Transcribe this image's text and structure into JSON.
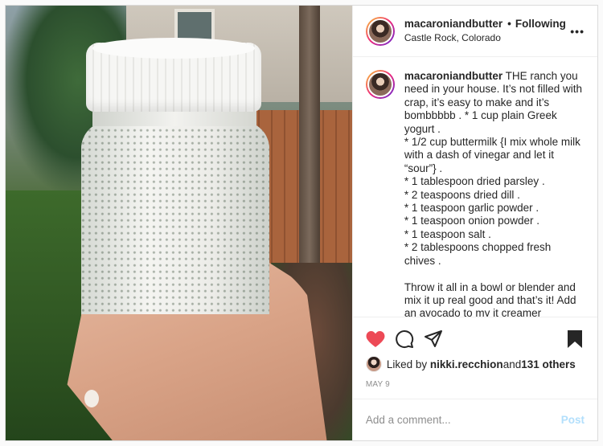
{
  "post": {
    "username": "macaroniandbutter",
    "follow_status": "Following",
    "location": "Castle Rock, Colorado",
    "more_label": "•••",
    "caption_text": " THE ranch you need in your house. It’s not filled with crap, it’s easy to make and it’s bombbbbb . * 1 cup plain Greek yogurt .\n* 1/2 cup buttermilk {I mix whole milk with a dash of vinegar and let it “sour”} .\n* 1 tablespoon dried parsley .\n* 2 teaspoons dried dill .\n* 1 teaspoon garlic powder .\n* 1 teaspoon onion powder .\n* 1 teaspoon salt .\n* 2 tablespoons chopped fresh chives .\n\nThrow it all in a bowl or blender and mix it up real good and that’s it! Add an avocado to my it creamer",
    "likes": {
      "prefix": "Liked by ",
      "liker": "nikki.recchion",
      "suffix": " and ",
      "others": "131 others"
    },
    "date": "MAY 9",
    "comment_placeholder": "Add a comment...",
    "post_button": "Post"
  },
  "icons": {
    "like": "heart-filled-icon",
    "comment": "comment-bubble-icon",
    "share": "paper-plane-icon",
    "save": "bookmark-filled-icon"
  },
  "colors": {
    "like_red": "#ed4956",
    "post_blue_disabled": "#b2dffc",
    "muted": "#8e8e8e",
    "text": "#262626"
  }
}
